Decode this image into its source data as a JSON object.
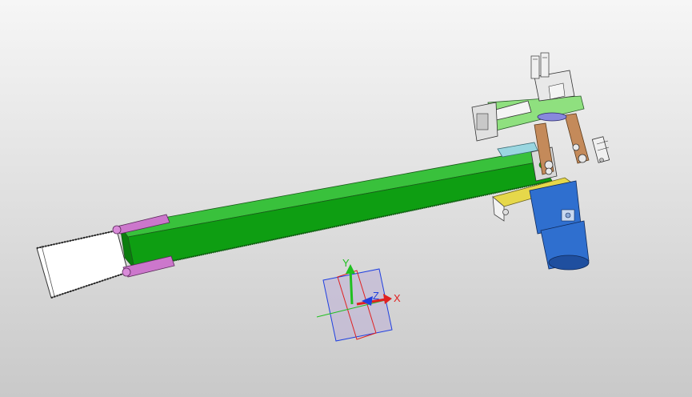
{
  "viewport": {
    "background_top": "#f6f6f6",
    "background_bottom": "#c9c9c9"
  },
  "model": {
    "colors": {
      "arm": "#0e9e12",
      "arm_shadow": "#0a7d0d",
      "arm_highlight": "#39c13c",
      "clamp": "#cc77cc",
      "bracket_yellow": "#e6d84a",
      "motor": "#2f6fcf",
      "motor_dark": "#1f4f9f",
      "link": "#c48a5a",
      "gripper_body": "#8fe07f",
      "cyan_part": "#9ad6e0",
      "end_frame": "#ffffff"
    }
  },
  "triad": {
    "x_label": "X",
    "y_label": "Y",
    "z_label": "Z",
    "colors": {
      "x": "#e02020",
      "y": "#20c020",
      "z": "#2040e0",
      "plane": "#b8a8d8"
    }
  }
}
